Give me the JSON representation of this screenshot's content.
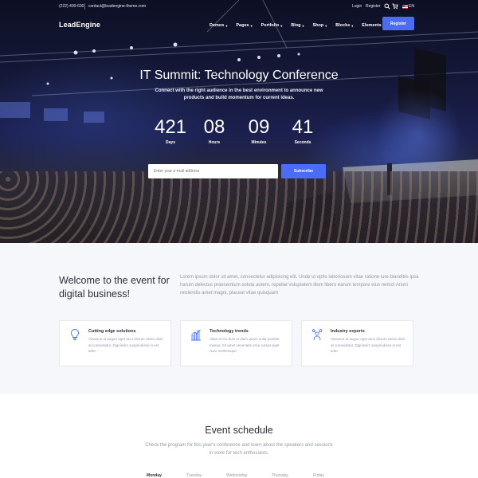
{
  "topbar": {
    "phone": "(222) 400-630",
    "email": "contact@leadengine-theme.com",
    "login": "Login",
    "register": "Register",
    "search_icon": "search-icon",
    "cart_icon": "cart-icon",
    "language": "EN"
  },
  "nav": {
    "logo": "LeadEngine",
    "items": [
      {
        "label": "Demos"
      },
      {
        "label": "Pages"
      },
      {
        "label": "Portfolio"
      },
      {
        "label": "Blog"
      },
      {
        "label": "Shop"
      },
      {
        "label": "Blocks"
      },
      {
        "label": "Elements"
      }
    ],
    "register_button": "Register"
  },
  "hero": {
    "title": "IT Summit: Technology Conference",
    "subtitle": "Connect with the right audience in the best environment to announce new products and build momentum for current ideas.",
    "countdown": [
      {
        "value": "421",
        "label": "Days"
      },
      {
        "value": "08",
        "label": "Hours"
      },
      {
        "value": "09",
        "label": "Minutes"
      },
      {
        "value": "41",
        "label": "Seconds"
      }
    ],
    "email_placeholder": "Enter your e-mail address",
    "subscribe_label": "Subscribe"
  },
  "welcome": {
    "title": "Welcome to the event for digital business!",
    "text": "Lorem ipsum dolor sit amet, consectetur adipisicing elit. Unde ut optio laboriosam vitae ratione iure blanditiis ipsa harum delectus praesentium soluta autem, repellat voluptatem illum libero earum tempore eius nemo! Animi reiciendis amet magni, placeat vitae quisquam",
    "cards": [
      {
        "title": "Cutting edge solutions",
        "body": "Vivamus at augue eget arcu dictum varius duis at consectetur. Dignissim suspendisse in est ante.",
        "icon": "lightbulb-icon"
      },
      {
        "title": "Technology trends",
        "body": "Vitae et leo duis ut diam quam nulla porttitor massa. Sit amet venenatis urna cursus eget nunc scelerisque.",
        "icon": "bar-chart-icon"
      },
      {
        "title": "Industry experts",
        "body": "Vivamus at augue eget arcu dictum varius duis at consectetur. Dignissim suspendisse in est ante.",
        "icon": "people-network-icon"
      }
    ]
  },
  "schedule": {
    "title": "Event schedule",
    "subtitle": "Check the program for this year's conference and learn about the speakers and sessions in store for tech enthusiasts.",
    "days": [
      "Monday",
      "Tuesday",
      "Wednesday",
      "Thursday",
      "Friday"
    ]
  },
  "colors": {
    "accent": "#4a6cf7",
    "text_dark": "#2b2f3a",
    "text_muted": "#9199a6",
    "section_bg": "#f5f7fa"
  }
}
